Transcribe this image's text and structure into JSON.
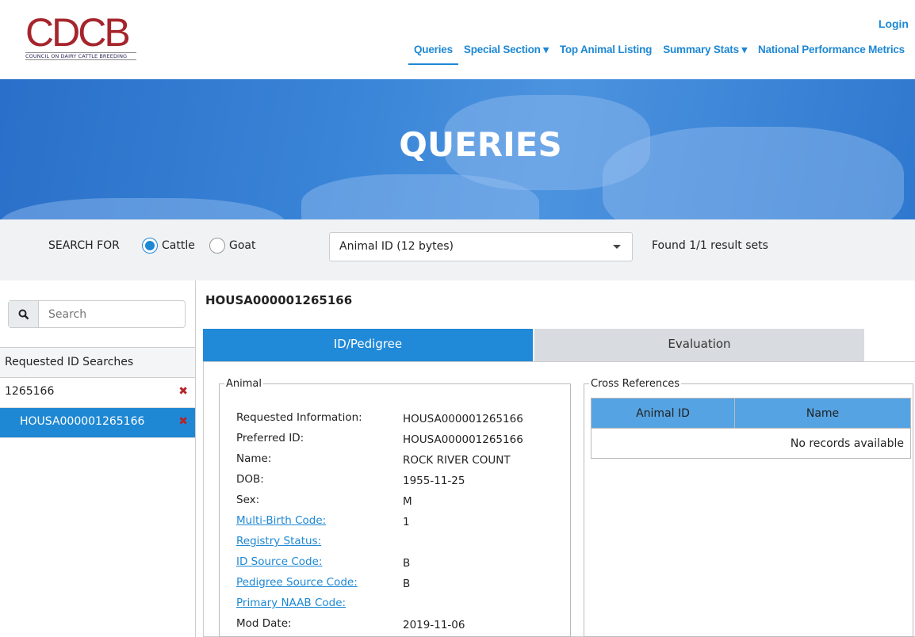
{
  "logo": {
    "letters": "CDCB",
    "subtitle": "COUNCIL ON DAIRY CATTLE BREEDING"
  },
  "header": {
    "login": "Login",
    "nav": [
      {
        "label": "Queries",
        "active": true
      },
      {
        "label": "Special Section ▾"
      },
      {
        "label": "Top Animal Listing"
      },
      {
        "label": "Summary Stats ▾"
      },
      {
        "label": "National Performance Metrics"
      }
    ]
  },
  "hero": {
    "title": "QUERIES"
  },
  "search": {
    "label": "SEARCH FOR",
    "options": [
      {
        "label": "Cattle",
        "checked": true
      },
      {
        "label": "Goat",
        "checked": false
      }
    ],
    "id_type": "Animal ID (12 bytes)",
    "found": "Found 1/1 result sets"
  },
  "sidebar": {
    "search_placeholder": "Search",
    "heading": "Requested ID Searches",
    "items": [
      {
        "label": "1265166"
      },
      {
        "label": "HOUSA000001265166",
        "selected": true
      }
    ]
  },
  "main": {
    "title": "HOUSA000001265166",
    "tabs": [
      {
        "label": "ID/Pedigree",
        "active": true
      },
      {
        "label": "Evaluation"
      }
    ],
    "animal": {
      "legend": "Animal",
      "fields": [
        {
          "label": "Requested Information:",
          "value": "HOUSA000001265166"
        },
        {
          "label": "Preferred ID:",
          "value": "HOUSA000001265166"
        },
        {
          "label": "Name:",
          "value": "ROCK RIVER COUNT"
        },
        {
          "label": "DOB:",
          "value": "1955-11-25"
        },
        {
          "label": "Sex:",
          "value": "M"
        },
        {
          "label": "Multi-Birth Code:",
          "value": "1",
          "link": true
        },
        {
          "label": "Registry Status:",
          "value": "",
          "link": true
        },
        {
          "label": "ID Source Code:",
          "value": "B",
          "link": true
        },
        {
          "label": "Pedigree Source Code:",
          "value": "B",
          "link": true
        },
        {
          "label": "Primary NAAB Code:",
          "value": "",
          "link": true
        },
        {
          "label": "Mod Date:",
          "value": "2019-11-06"
        }
      ]
    },
    "cross": {
      "legend": "Cross References",
      "columns": [
        "Animal ID",
        "Name"
      ],
      "empty": "No records available"
    }
  },
  "colors": {
    "accent": "#1e88d4",
    "logo_red": "#a6252c",
    "logo_navy": "#2b2a5c",
    "remove": "#b3262c"
  }
}
